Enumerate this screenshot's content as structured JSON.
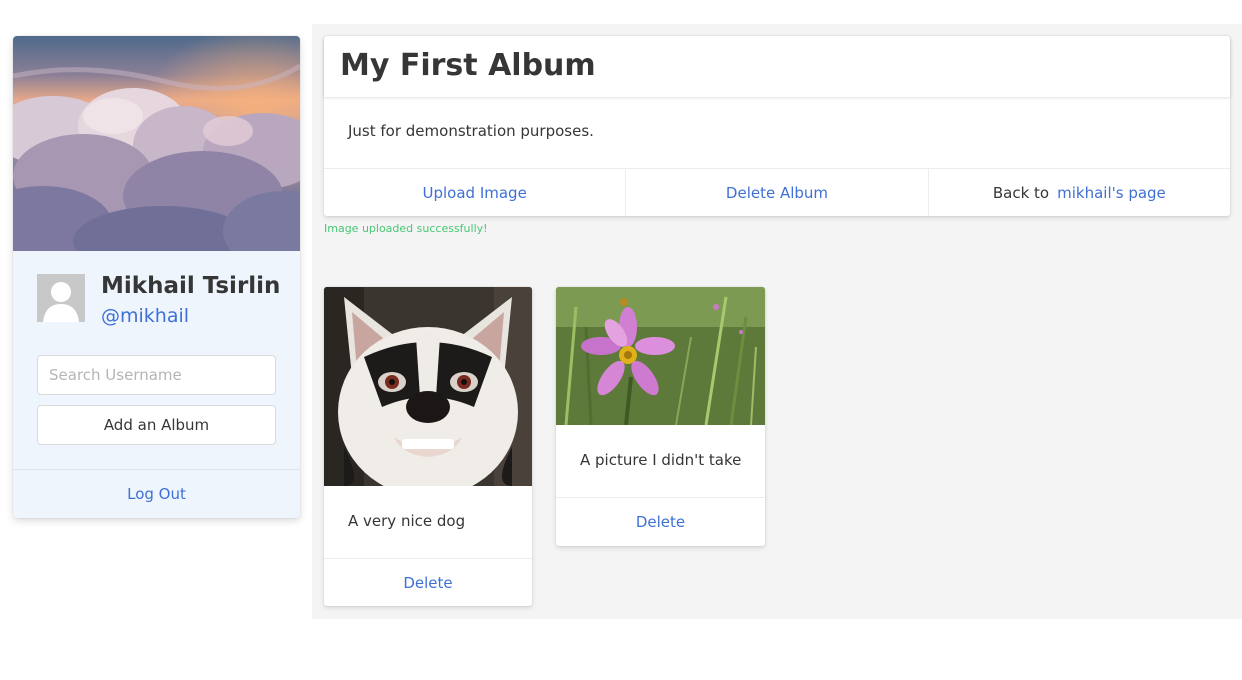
{
  "profile": {
    "name": "Mikhail Tsirlin",
    "handle": "@mikhail",
    "search_placeholder": "Search Username",
    "add_album_label": "Add an Album",
    "logout_label": "Log Out"
  },
  "album": {
    "title": "My First Album",
    "description": "Just for demonstration purposes.",
    "actions": {
      "upload_label": "Upload Image",
      "delete_label": "Delete Album",
      "back_prefix": "Back to",
      "back_link": "mikhail's page"
    },
    "flash_message": "Image uploaded successfully!"
  },
  "images": [
    {
      "caption": "A very nice dog",
      "delete_label": "Delete"
    },
    {
      "caption": "A picture I didn't take",
      "delete_label": "Delete"
    }
  ],
  "colors": {
    "link": "#3e70d6",
    "success": "#48c774",
    "profile_bg": "#eef5fc",
    "main_bg": "#f4f4f4"
  },
  "icons": [
    "avatar-placeholder-icon"
  ]
}
